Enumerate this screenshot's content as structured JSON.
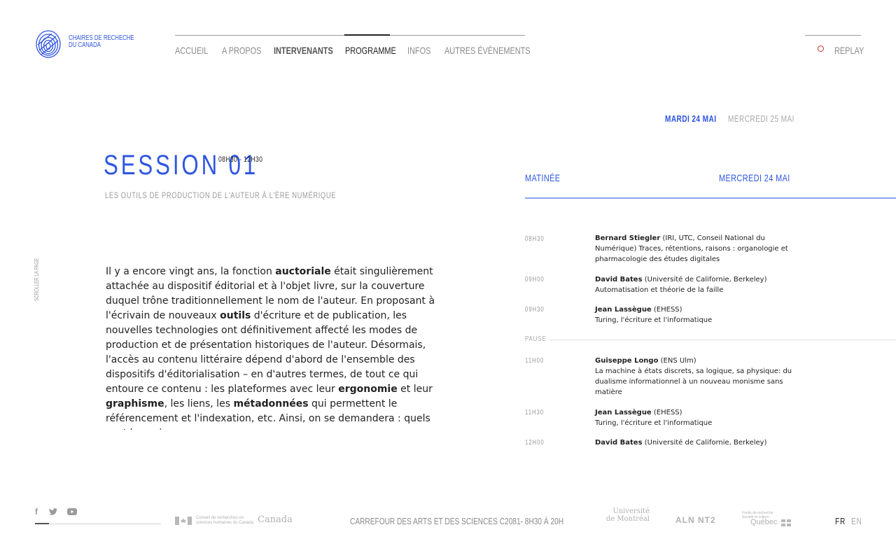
{
  "brand": {
    "line1": "Chaires de recheche",
    "line2": "du Canada"
  },
  "nav": {
    "items": [
      {
        "label": "Accueil"
      },
      {
        "label": "A propos"
      },
      {
        "label": "Intervenants"
      },
      {
        "label": "Programme"
      },
      {
        "label": "Infos"
      },
      {
        "label": "Autres évènements"
      }
    ],
    "active": "Programme",
    "replay_label": "Replay"
  },
  "days": [
    {
      "label": "Mardi 24 mai",
      "active": true
    },
    {
      "label": "Mercredi 25 mai",
      "active": false
    }
  ],
  "session": {
    "title": "Session 01",
    "time": "08H30 - 12H30",
    "subtitle": "Les outils de production de l'auteur à l'ère numérique",
    "scroll_hint": "Scroller la page"
  },
  "intro": {
    "segments": [
      {
        "t": "Il y a encore vingt ans, la fonction "
      },
      {
        "t": "auctoriale",
        "b": true
      },
      {
        "t": " était singulièrement attachée au dispositif éditorial et à l'objet livre, sur la couverture duquel trône traditionnellement le nom de l'auteur. En proposant à l'écrivain de nouveaux "
      },
      {
        "t": "outils",
        "b": true
      },
      {
        "t": " d'écriture et de publication, les nouvelles technologies ont définitivement affecté les modes de production et de présentation historiques de l'auteur. Désormais, l'accès au contenu littéraire dépend d'abord de l'ensemble des dispositifs d'éditorialisation – en d'autres termes, de tout ce qui entoure ce contenu : les plateformes avec leur "
      },
      {
        "t": "ergonomie",
        "b": true
      },
      {
        "t": " et leur "
      },
      {
        "t": "graphisme",
        "b": true
      },
      {
        "t": ", les liens, les "
      },
      {
        "t": "métadonnées",
        "b": true
      },
      {
        "t": " qui permettent le référencement et l'indexation, etc. Ainsi, on se demandera : quels sont les enjeux"
      }
    ]
  },
  "programme": {
    "period": "Matinée",
    "date": "Mercredi 24 mai",
    "pause_label": "Pause",
    "rows": [
      {
        "time": "08H30",
        "speaker": "Bernard Stiegler",
        "affiliation": "(IRI, UTC, Conseil National du Numérique)",
        "title": "Traces, rétentions, raisons : organologie et pharmacologie des études digitales"
      },
      {
        "time": "09H00",
        "speaker": "David Bates",
        "affiliation": "(Université de Californie, Berkeley)",
        "title": "Automatisation et théorie de la faille"
      },
      {
        "time": "09H30",
        "speaker": "Jean Lassègue",
        "affiliation": "(EHESS)",
        "title": "Turing, l'écriture et l'informatique"
      },
      {
        "time": "11H00",
        "speaker": "Guiseppe Longo",
        "affiliation": "(ENS Ulm)",
        "title": "La machine à états discrets, sa logique, sa physique: du dualisme informationnel à un nouveau monisme sans matière"
      },
      {
        "time": "11H30",
        "speaker": "Jean Lassègue",
        "affiliation": "(EHESS)",
        "title": "Turing, l'écriture et l'informatique"
      },
      {
        "time": "12H00",
        "speaker": "David Bates",
        "affiliation": "(Université de Californie, Berkeley)",
        "title": ""
      }
    ]
  },
  "footer": {
    "social": [
      "f",
      "twitter-icon",
      "youtube-icon"
    ],
    "partners": {
      "crsh_line1": "Conseil de recherches en",
      "crsh_line2": "sciences humaines du Canada",
      "canada": "Canada",
      "udem_line1": "Université",
      "udem_line2": "de Montréal",
      "alln": "ALN",
      "alln2": "NT2",
      "frq_line1": "Fonds de recherche",
      "frq_line2": "Société et culture",
      "quebec": "Québec"
    },
    "venue": "Carrefour des arts et des sciences C2081- 8H30 à 20H",
    "languages": [
      {
        "label": "FR",
        "active": true
      },
      {
        "label": "EN",
        "active": false
      }
    ]
  },
  "colors": {
    "accent": "#2f56e0",
    "replay": "#c0392b",
    "rule": "#8ea2f0"
  }
}
